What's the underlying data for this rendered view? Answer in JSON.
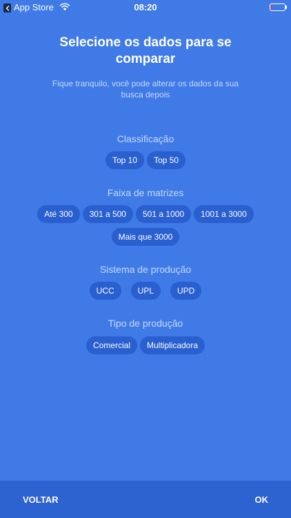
{
  "status_bar": {
    "back_app": "App Store",
    "time": "08:20"
  },
  "heading": {
    "title": "Selecione os dados para se comparar",
    "subtitle": "Fique tranquilo, você pode alterar os dados da sua busca depois"
  },
  "sections": {
    "classificacao": {
      "label": "Classificação",
      "options": [
        "Top 10",
        "Top 50"
      ]
    },
    "faixa": {
      "label": "Faixa de matrizes",
      "options": [
        "Até 300",
        "301 a 500",
        "501 a 1000",
        "1001 a 3000",
        "Mais que 3000"
      ]
    },
    "sistema": {
      "label": "Sistema de produção",
      "options": [
        "UCC",
        "UPL",
        "UPD"
      ]
    },
    "tipo": {
      "label": "Tipo de produção",
      "options": [
        "Comercial",
        "Multiplicadora"
      ]
    }
  },
  "footer": {
    "back_label": "VOLTAR",
    "ok_label": "OK"
  },
  "colors": {
    "background": "#3f7ae6",
    "chip": "#2a5fcf",
    "footer": "#2d62d1",
    "battery_low": "#e23c3c"
  }
}
